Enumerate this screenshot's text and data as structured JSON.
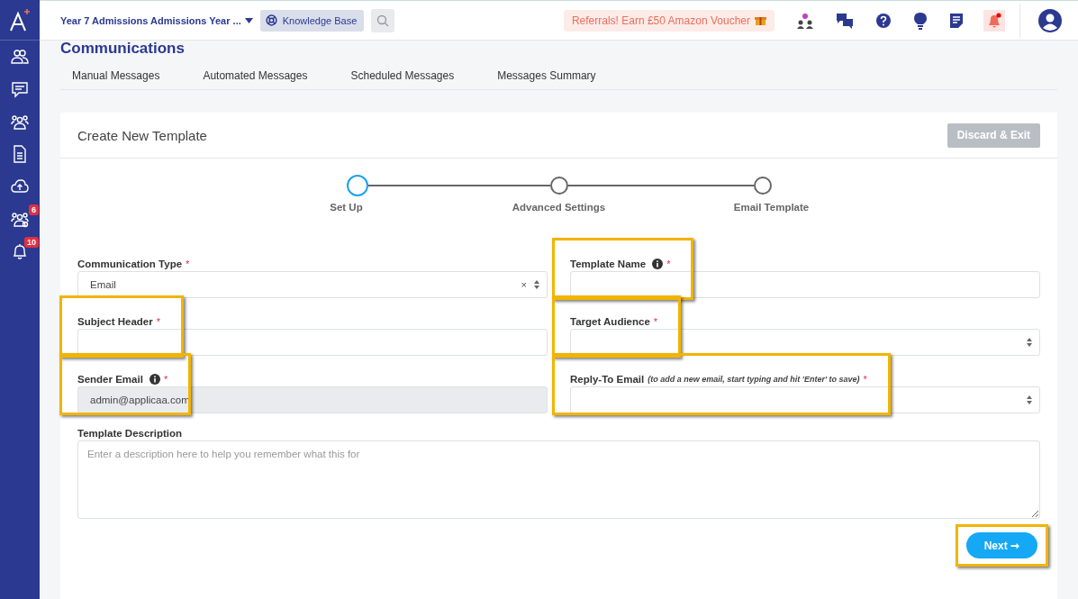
{
  "sidebar": {
    "items": [
      {
        "kind": "people"
      },
      {
        "kind": "chat"
      },
      {
        "kind": "group"
      },
      {
        "kind": "document"
      },
      {
        "kind": "upload"
      },
      {
        "kind": "group-settings",
        "badge": "6"
      },
      {
        "kind": "bell",
        "badge": "10"
      }
    ]
  },
  "topbar": {
    "context": "Year 7 Admissions Admissions Year ...",
    "knowledge_base": "Knowledge Base",
    "referral": "Referrals! Earn £50 Amazon Voucher"
  },
  "page_title": "Communications",
  "tabs": [
    {
      "label": "Manual Messages",
      "selected": false
    },
    {
      "label": "Automated Messages",
      "selected": false
    },
    {
      "label": "Scheduled Messages",
      "selected": false
    },
    {
      "label": "Messages Summary",
      "selected": false
    }
  ],
  "card": {
    "title": "Create New Template",
    "discard_button": "Discard & Exit",
    "steps": [
      {
        "label": "Set Up",
        "selected": true
      },
      {
        "label": "Advanced Settings",
        "selected": false
      },
      {
        "label": "Email Template",
        "selected": false
      }
    ],
    "fields": [
      {
        "label": "Communication Type",
        "kind": "select",
        "value": "Email",
        "clear_icon": "×",
        "info": false,
        "required_mark": "*",
        "disabled": false,
        "highlighted": false
      },
      {
        "label": "Template Name",
        "kind": "text",
        "info": true,
        "required_mark": "*",
        "disabled": false,
        "highlighted": true
      },
      {
        "label": "Subject Header",
        "kind": "text",
        "info": false,
        "required_mark": "*",
        "disabled": false,
        "highlighted": true
      },
      {
        "label": "Target Audience",
        "kind": "select",
        "info": false,
        "required_mark": "*",
        "disabled": false,
        "highlighted": true
      },
      {
        "label": "Sender Email",
        "kind": "text",
        "value": "admin@applicaa.com",
        "info": true,
        "required_mark": "*",
        "disabled": true,
        "highlighted": true
      },
      {
        "label": "Reply-To Email",
        "hint": "(to add a new email, start typing and hit 'Enter' to save)",
        "kind": "select",
        "info": false,
        "required_mark": "*",
        "disabled": false,
        "highlighted": true
      }
    ],
    "description": {
      "label": "Template Description",
      "placeholder": "Enter a description here to help you remember what this for"
    },
    "next_button": {
      "label": "Next",
      "arrow": "➞",
      "highlighted": true
    }
  }
}
